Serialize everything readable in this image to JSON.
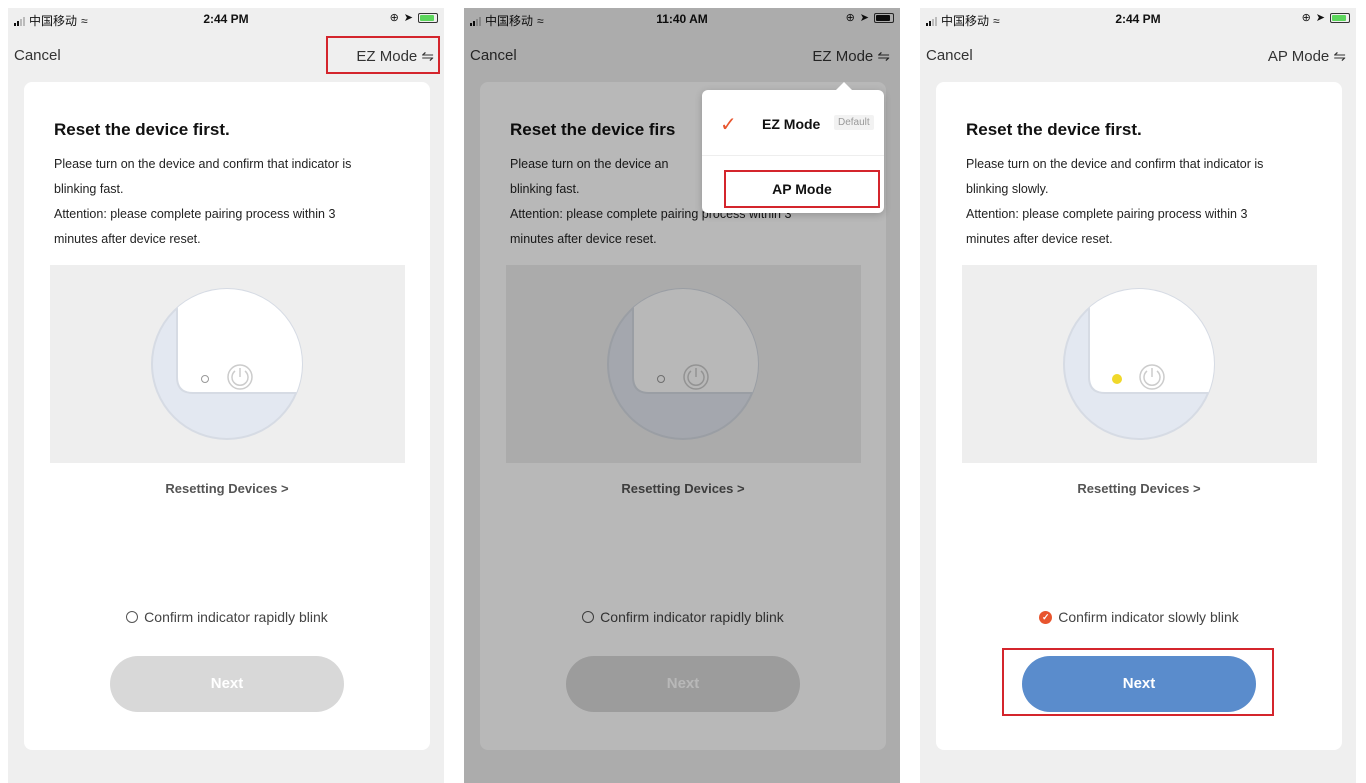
{
  "colors": {
    "accent": "#e8552e",
    "highlight": "#d4252c",
    "primary_button": "#5a8ccc",
    "indicator_yellow": "#f0d82a"
  },
  "screens": [
    {
      "status": {
        "carrier": "中国移动",
        "time": "2:44 PM"
      },
      "nav": {
        "cancel": "Cancel",
        "mode": "EZ Mode ⇋"
      },
      "title": "Reset the device first.",
      "desc": [
        "Please turn on the device and confirm that indicator is",
        "blinking fast.",
        "Attention: please complete pairing process within 3",
        "minutes after device reset."
      ],
      "reset_link": "Resetting Devices >",
      "confirm": "Confirm indicator rapidly blink",
      "next": "Next"
    },
    {
      "status": {
        "carrier": "中国移动",
        "time": "11:40 AM"
      },
      "nav": {
        "cancel": "Cancel",
        "mode": "EZ Mode ⇋"
      },
      "title": "Reset the device firs",
      "desc": [
        "Please turn on the device an",
        "blinking fast.",
        "Attention: please complete pairing process within 3",
        "minutes after device reset."
      ],
      "reset_link": "Resetting Devices >",
      "confirm": "Confirm indicator rapidly blink",
      "next": "Next",
      "dropdown": {
        "ez": "EZ Mode",
        "default_badge": "Default",
        "ap": "AP Mode"
      }
    },
    {
      "status": {
        "carrier": "中国移动",
        "time": "2:44 PM"
      },
      "nav": {
        "cancel": "Cancel",
        "mode": "AP Mode ⇋"
      },
      "title": "Reset the device first.",
      "desc": [
        "Please turn on the device and confirm that indicator is",
        "blinking slowly.",
        "Attention: please complete pairing process within 3",
        "minutes after device reset."
      ],
      "reset_link": "Resetting Devices >",
      "confirm": "Confirm indicator slowly blink",
      "next": "Next"
    }
  ]
}
